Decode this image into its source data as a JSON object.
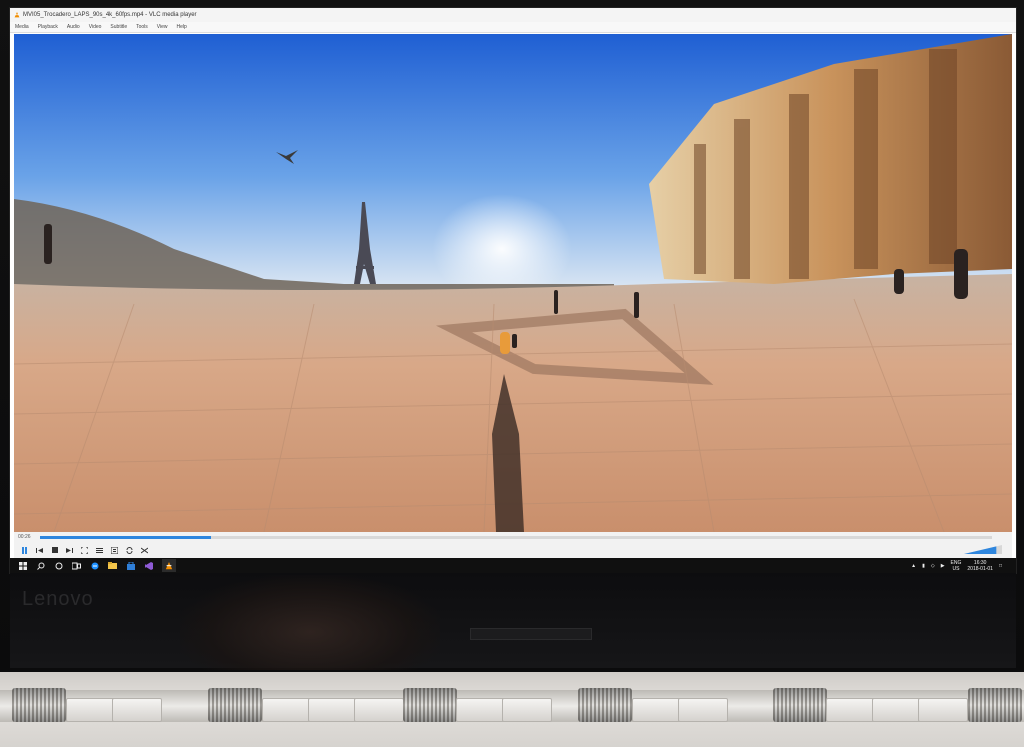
{
  "window": {
    "title": "MVI05_Trocadero_LAPS_90s_4k_60fps.mp4 - VLC media player"
  },
  "menu": [
    "Media",
    "Playback",
    "Audio",
    "Video",
    "Subtitle",
    "Tools",
    "View",
    "Help"
  ],
  "player": {
    "elapsed": "00:26",
    "progress": 0.18,
    "volume": 0.85
  },
  "taskbar": {
    "lang_top": "ENG",
    "lang_bottom": "US",
    "clock_time": "16:30",
    "clock_date": "2018-01-01"
  },
  "device": {
    "brand": "Lenovo"
  },
  "icons": {
    "start": "windows-start-icon",
    "search": "search-icon",
    "cortana": "cortana-icon",
    "taskview": "task-view-icon",
    "edge": "edge-icon",
    "explorer": "file-explorer-icon",
    "store": "store-icon",
    "visual_studio": "visual-studio-icon",
    "vlc": "vlc-icon"
  },
  "colors": {
    "seek": "#2e86de",
    "vlc_orange": "#f08c00",
    "taskbar": "#101010"
  }
}
